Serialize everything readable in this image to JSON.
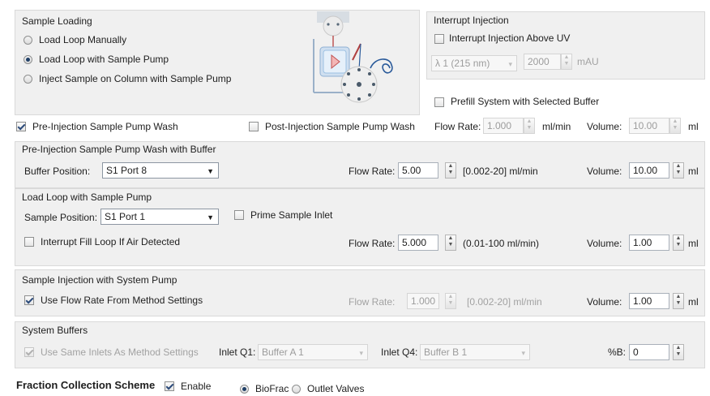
{
  "sample_loading": {
    "title": "Sample Loading",
    "options": [
      "Load Loop Manually",
      "Load Loop with Sample Pump",
      "Inject Sample on Column with Sample Pump"
    ],
    "selected_index": 1
  },
  "interrupt_injection": {
    "title": "Interrupt Injection",
    "above_uv_label": "Interrupt Injection Above UV",
    "above_uv_checked": false,
    "wavelength": "λ 1 (215 nm)",
    "threshold": "2000",
    "unit": "mAU"
  },
  "prefill": {
    "label": "Prefill System with Selected Buffer",
    "checked": false,
    "flow_label": "Flow Rate:",
    "flow_value": "1.000",
    "flow_unit": "ml/min",
    "volume_label": "Volume:",
    "volume_value": "10.00",
    "volume_unit": "ml"
  },
  "pre_wash_check": {
    "label": "Pre-Injection Sample Pump Wash",
    "checked": true
  },
  "post_wash_check": {
    "label": "Post-Injection Sample Pump Wash",
    "checked": false
  },
  "pre_wash_buffer": {
    "title": "Pre-Injection Sample Pump Wash with Buffer",
    "position_label": "Buffer Position:",
    "position_value": "S1 Port 8",
    "flow_label": "Flow Rate:",
    "flow_value": "5.00",
    "flow_range": "[0.002-20] ml/min",
    "volume_label": "Volume:",
    "volume_value": "10.00",
    "volume_unit": "ml"
  },
  "load_loop": {
    "title": "Load Loop with Sample Pump",
    "position_label": "Sample Position:",
    "position_value": "S1 Port 1",
    "prime_label": "Prime Sample Inlet",
    "prime_checked": false,
    "air_label": "Interrupt Fill Loop If Air Detected",
    "air_checked": false,
    "flow_label": "Flow Rate:",
    "flow_value": "5.000",
    "flow_range": "(0.01-100 ml/min)",
    "volume_label": "Volume:",
    "volume_value": "1.00",
    "volume_unit": "ml"
  },
  "sample_injection": {
    "title": "Sample Injection with System Pump",
    "use_flow_label": "Use Flow Rate From Method Settings",
    "use_flow_checked": true,
    "flow_label": "Flow Rate:",
    "flow_value": "1.000",
    "flow_range": "[0.002-20] ml/min",
    "volume_label": "Volume:",
    "volume_value": "1.00",
    "volume_unit": "ml"
  },
  "system_buffers": {
    "title": "System Buffers",
    "same_inlets_label": "Use Same Inlets As Method Settings",
    "same_inlets_checked": true,
    "inlet_q1_label": "Inlet Q1:",
    "inlet_q1_value": "Buffer A 1",
    "inlet_q4_label": "Inlet Q4:",
    "inlet_q4_value": "Buffer B 1",
    "percent_b_label": "%B:",
    "percent_b_value": "0"
  },
  "fraction": {
    "title": "Fraction Collection Scheme",
    "enable_label": "Enable",
    "enable_checked": true,
    "options": [
      "BioFrac",
      "Outlet Valves"
    ],
    "selected_index": 0
  },
  "icons": {
    "diagram": "sample-loading-diagram-icon",
    "spinner": "spin-updown-icon",
    "dropdown": "chevron-down-icon"
  }
}
